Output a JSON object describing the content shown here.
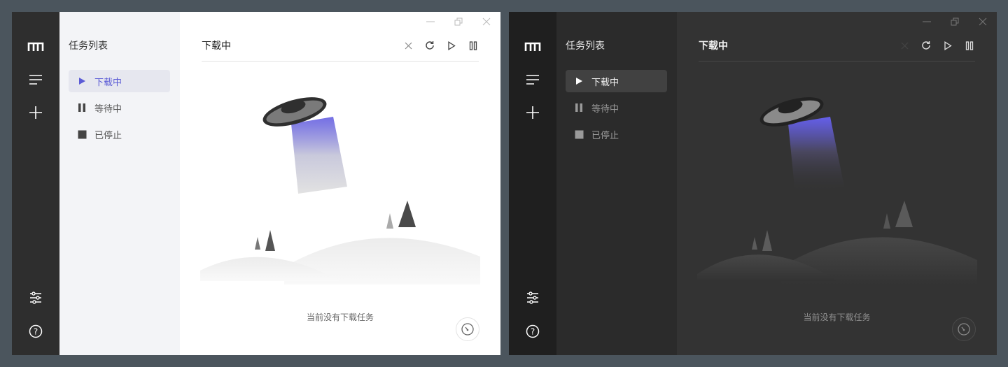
{
  "sidebar": {
    "title": "任务列表",
    "items": [
      {
        "label": "下载中",
        "icon": "play-icon"
      },
      {
        "label": "等待中",
        "icon": "pause-icon"
      },
      {
        "label": "已停止",
        "icon": "stop-icon"
      }
    ]
  },
  "main": {
    "title": "下载中",
    "empty_message": "当前没有下载任务"
  },
  "rail": {
    "icons": [
      "logo-icon",
      "menu-icon",
      "add-icon",
      "settings-icon",
      "help-icon"
    ]
  },
  "toolbar": {
    "icons": [
      "close-icon",
      "refresh-icon",
      "play-icon",
      "pause-icon"
    ]
  },
  "window_controls": [
    "minimize-icon",
    "maximize-icon",
    "close-icon"
  ],
  "colors": {
    "accent": "#5b5bd6",
    "light_rail": "#2e2e2e",
    "dark_rail": "#1f1f1f"
  }
}
